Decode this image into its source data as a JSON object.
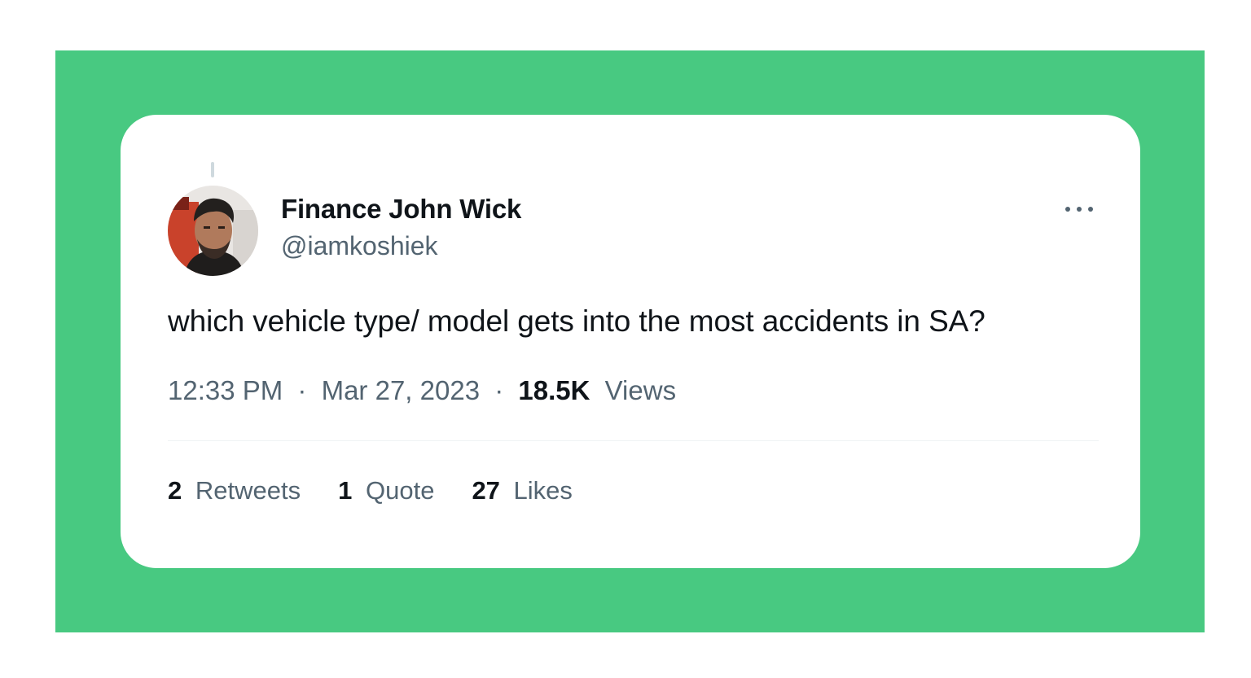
{
  "colors": {
    "panel_background": "#48c981",
    "card_background": "#ffffff",
    "primary_text": "#0f1419",
    "secondary_text": "#536471"
  },
  "tweet": {
    "display_name": "Finance John Wick",
    "handle": "@iamkoshiek",
    "text": "which vehicle type/ model gets into the most accidents in SA?",
    "time": "12:33 PM",
    "date": "Mar 27, 2023",
    "separator": "·",
    "views_count": "18.5K",
    "views_label": "Views",
    "more_icon": "ellipsis-horizontal-icon",
    "avatar_icon": "profile-photo"
  },
  "stats": {
    "retweets_count": "2",
    "retweets_label": "Retweets",
    "quote_count": "1",
    "quote_label": "Quote",
    "likes_count": "27",
    "likes_label": "Likes"
  }
}
